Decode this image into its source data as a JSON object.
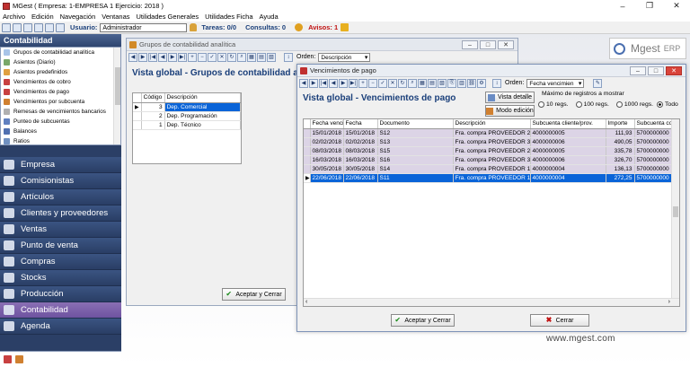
{
  "app": {
    "title": "MGest ( Empresa: 1-EMPRESA 1 Ejercicio: 2018 )",
    "minimize": "–",
    "maximize": "❐",
    "close": "✕"
  },
  "menu": [
    "Archivo",
    "Edición",
    "Navegación",
    "Ventanas",
    "Utilidades Generales",
    "Utilidades Ficha",
    "Ayuda"
  ],
  "toolbar": {
    "usuario_label": "Usuario:",
    "usuario_value": "Administrador",
    "tareas": "Tareas: 0/0",
    "consultas": "Consultas: 0",
    "avisos": "Avisos: 1"
  },
  "left_panel": {
    "header": "Contabilidad",
    "items": [
      {
        "label": "Grupos de contabilidad analítica",
        "icon": "#a8c4e8"
      },
      {
        "label": "Asientos (Diario)",
        "icon": "#7aa86a"
      },
      {
        "label": "Asientos predefinidos",
        "icon": "#e0a040"
      },
      {
        "label": "Vencimientos de cobro",
        "icon": "#c84040"
      },
      {
        "label": "Vencimientos de pago",
        "icon": "#c84040"
      },
      {
        "label": "Vencimientos por subcuenta",
        "icon": "#d08030"
      },
      {
        "label": "Remesas de vencimientos bancarios",
        "icon": "#b0b0b0"
      },
      {
        "label": "Punteo de subcuentas",
        "icon": "#6080c0"
      },
      {
        "label": "Balances",
        "icon": "#5070b0"
      },
      {
        "label": "Ratios",
        "icon": "#7090c0"
      }
    ],
    "nav": [
      "Empresa",
      "Comisionistas",
      "Artículos",
      "Clientes y proveedores",
      "Ventas",
      "Punto de venta",
      "Compras",
      "Stocks",
      "Producción",
      "Contabilidad",
      "Agenda"
    ],
    "active_nav": "Contabilidad"
  },
  "logo": {
    "text": "Mgest",
    "suffix": "ERP"
  },
  "website": "www.mgest.com",
  "win1": {
    "title": "Grupos de contabilidad analítica",
    "heading": "Vista global  -  Grupos de contabilidad anal",
    "orden_label": "Orden:",
    "orden_value": "Descripción",
    "columns": [
      "Código",
      "Descripción"
    ],
    "rows": [
      [
        "3",
        "Dep. Comercial"
      ],
      [
        "2",
        "Dep. Programación"
      ],
      [
        "1",
        "Dep. Técnico"
      ]
    ],
    "accept": "Aceptar y Cerrar"
  },
  "win2": {
    "title": "Vencimientos de pago",
    "heading": "Vista global  -  Vencimientos de pago",
    "vista_detalle": "Vista detalle",
    "modo_edicion": "Modo edición",
    "orden_label": "Orden:",
    "orden_value": "Fecha vencimien",
    "max_label": "Máximo de registros a mostrar",
    "radios": [
      "10 regs.",
      "100 regs.",
      "1000 regs.",
      "Todo"
    ],
    "radio_selected": "Todo",
    "columns": [
      "Fecha venci",
      "Fecha",
      "Documento",
      "Descripción",
      "Subcuenta cliente/prov.",
      "Importe",
      "Subcuenta co"
    ],
    "rows": [
      [
        "15/01/2018",
        "15/01/2018",
        "S12",
        "Fra. compra PROVEEDOR 2",
        "4000000005",
        "111,93",
        "5700000000"
      ],
      [
        "02/02/2018",
        "02/02/2018",
        "S13",
        "Fra. compra PROVEEDOR 3",
        "4000000006",
        "490,05",
        "5700000000"
      ],
      [
        "08/03/2018",
        "08/03/2018",
        "S15",
        "Fra. compra PROVEEDOR 2",
        "4000000005",
        "335,78",
        "5700000000"
      ],
      [
        "16/03/2018",
        "16/03/2018",
        "S16",
        "Fra. compra PROVEEDOR 3",
        "4000000006",
        "326,70",
        "5700000000"
      ],
      [
        "30/05/2018",
        "30/05/2018",
        "S14",
        "Fra. compra PROVEEDOR 1",
        "4000000004",
        "136,13",
        "5700000000"
      ],
      [
        "22/06/2018",
        "22/06/2018",
        "S11",
        "Fra. compra PROVEEDOR 1",
        "4000000004",
        "272,25",
        "5700000000"
      ]
    ],
    "accept": "Aceptar y Cerrar",
    "cancel": "Cerrar"
  }
}
